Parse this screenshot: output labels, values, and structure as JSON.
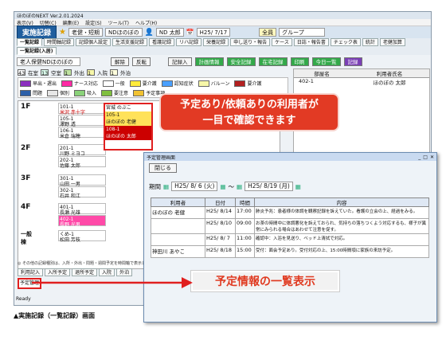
{
  "app": {
    "title": "ほのぼのNEXT Ver.2.01.2024"
  },
  "menu": [
    "表示(V)",
    "切替(C)",
    "編集(E)",
    "設定(S)",
    "ツール(T)",
    "ヘルプ(H)"
  ],
  "toolbar": {
    "title": "実施記録",
    "service": "老健・短期",
    "facility": "NDほのぼの",
    "user": "ND 太郎",
    "date": "H25/ 7/17",
    "group_label": "グループ",
    "group_value": "全員"
  },
  "tabs_top": [
    "一覧記録",
    "時間軸記録",
    "記録個人設定",
    "生活支援記録",
    "看護記録",
    "リハ記録",
    "栄養記録",
    "申し送り・報告",
    "ケース",
    "日誌・報告書",
    "チェック表",
    "統計",
    "老健加算"
  ],
  "tab_sub": "一覧記録(入居)",
  "controls": {
    "resident_search": "老人保健NDほのぼの",
    "btn1": "解除",
    "btn2": "反転",
    "btn3": "記録入",
    "btn4": "計画情報",
    "btn5": "安全記録",
    "btn6": "在宅記録",
    "btn7": "印刷",
    "btn8": "今日一覧",
    "btn9": "記録"
  },
  "status": {
    "zaishitsu": "在室",
    "zaishitsu_n": "43",
    "kuushitsu": "空室",
    "kuushitsu_n": "13",
    "gaishutsu": "外出",
    "gaishutsu_n": "1",
    "nyuin": "入院",
    "nyuin_n": "1",
    "gaihaku": "外泊",
    "gaihaku_n": "1"
  },
  "legend": [
    "早出・遅出",
    "ナース対応",
    "一般",
    "要介護",
    "認知症状",
    "バルーン",
    "要介護",
    "問題",
    "個別",
    "吸入",
    "要注意",
    "予定事項"
  ],
  "legend_colors": [
    "#8c2fbf",
    "#ff2ba5",
    "#ffffff",
    "#ffeb3b",
    "#4aa0ff",
    "#f7f7a8",
    "#b32020",
    "#2c5fa8",
    "#e7e7e7",
    "#8ad27a",
    "#7fbf3f",
    "#f1c232"
  ],
  "floors": [
    "1F",
    "2F",
    "3F",
    "4F",
    "一般棟"
  ],
  "rooms": [
    {
      "no": "101-1",
      "name": "米沢 赤十字",
      "red": true
    },
    {
      "no": "105-1",
      "name": "澤野 透"
    },
    {
      "no": "106-1",
      "name": "米倉 瑞穂"
    },
    {
      "no": "201-1",
      "name": "川野 ミヨコ"
    },
    {
      "no": "202-1",
      "name": "佐藤 太郎"
    },
    {
      "no": "301-1",
      "name": "山田 一男"
    },
    {
      "no": "302-1",
      "name": "石井 和江"
    },
    {
      "no": "401-1",
      "name": "長瀬 光雄"
    },
    {
      "no": "402-1",
      "name": "長野 光男"
    },
    {
      "no": "くめ-1",
      "name": "松田 芳枝"
    }
  ],
  "dropdown_rooms": [
    "宮城 のぶこ",
    "105-1",
    "ほのぼの 老健",
    "108-1",
    "ほのぼの 太郎"
  ],
  "right_panel": {
    "col_room": "部屋名",
    "col_name": "利用者氏名",
    "room": "402-1",
    "name": "ほのぼの 太郎"
  },
  "callouts": {
    "top": "予定あり/依頼ありの利用者が\n一目で確認できます",
    "bottom": "予定情報の一覧表示"
  },
  "bottom_tabs": [
    "利用記入",
    "入所予定",
    "退所予定",
    "入院",
    "外泊"
  ],
  "bottom_btn": "予定管理",
  "note": "◎ その他の記録種別は、入所・外出・問題・週間予定を時間軸で表示します。",
  "status_bar": "Ready",
  "popup": {
    "title": "予定管理画面",
    "close": "閉じる",
    "period_label": "期間",
    "date_from": "H25/ 8/ 6 (火)",
    "date_to": "H25/ 8/19 (月)",
    "headers": [
      "利用者",
      "日付",
      "時間",
      "内容"
    ],
    "rows": [
      {
        "name": "ほのぼの 老健",
        "date": "H25/ 8/14",
        "time": "17:00",
        "content": "肺炎予兆：患者様の体調を観察記録を訴えていた。看護の立会の上、経過をみる。"
      },
      {
        "name": "",
        "date": "H25/ 8/10",
        "time": "09:00",
        "content": "お茶の時間中に体調悪化を訴えておられ、気持ちの落ちつくよう対応するも、様子が異常にみられる場合はあわせて注意を促す。"
      },
      {
        "name": "",
        "date": "H25/ 8/ 7",
        "time": "11:00",
        "content": "確認中：入浴を見送り、ベッド上清拭で対応。"
      },
      {
        "name": "神田川 あやこ",
        "date": "H25/ 8/18",
        "time": "15:00",
        "content": "受付：面会予定あり。受付対応の上、15:00時間頃に家族の来訪予定。"
      }
    ]
  },
  "caption": "▲実施記録（一覧記録）画面"
}
